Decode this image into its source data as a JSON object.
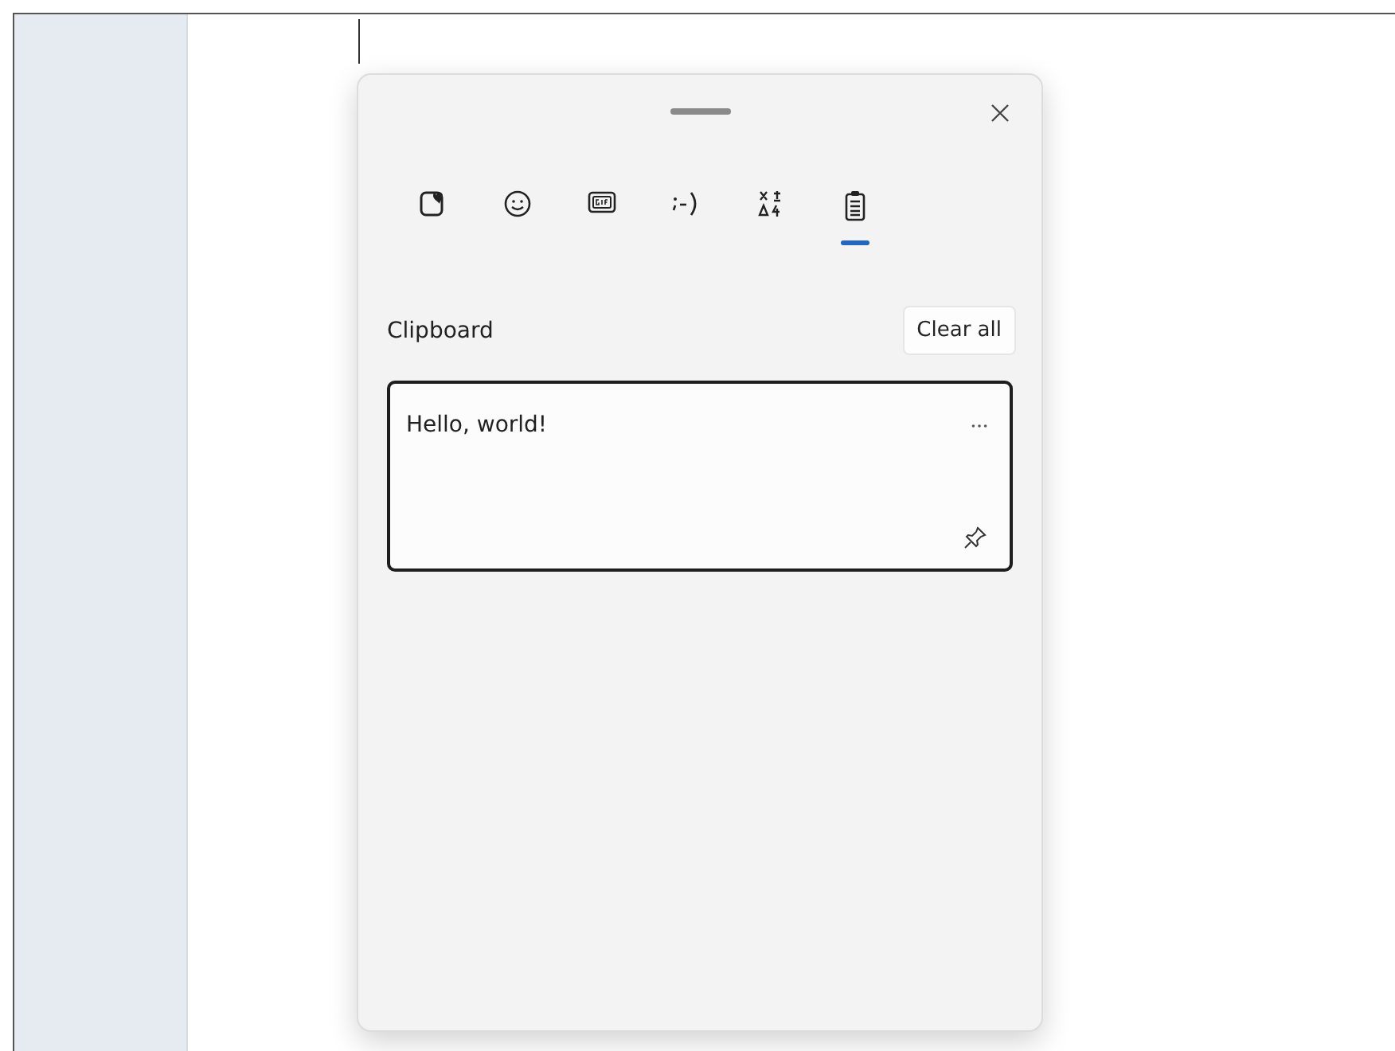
{
  "tabs": [
    {
      "kind": "stickers",
      "selected": false
    },
    {
      "kind": "emoji",
      "selected": false
    },
    {
      "kind": "gif",
      "selected": false
    },
    {
      "kind": "kaomoji",
      "selected": false
    },
    {
      "kind": "symbols",
      "selected": false
    },
    {
      "kind": "clipboard",
      "selected": true
    }
  ],
  "section": {
    "title": "Clipboard",
    "clear_button": "Clear all"
  },
  "clips": [
    {
      "text": "Hello, world!",
      "pinned": false
    }
  ]
}
